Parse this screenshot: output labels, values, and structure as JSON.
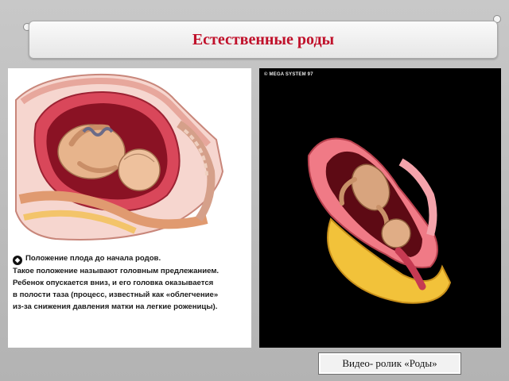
{
  "slide": {
    "title": "Естественные роды"
  },
  "left_figure": {
    "caption_lines": [
      "Положение плода до начала родов.",
      "Такое положение называют головным предлежанием.",
      "Ребенок опускается вниз, и его головка оказывается",
      "в полости таза (процесс, известный как «облегчение»",
      "из-за снижения давления матки на легкие роженицы)."
    ]
  },
  "right_figure": {
    "copyright": "© MEGA SYSTEM 97"
  },
  "video_button": {
    "label": "Видео- ролик «Роды»"
  },
  "colors": {
    "title": "#c0102a",
    "uterus": "#d9475a",
    "tissue_pink": "#f0b8b0",
    "fetus_skin": "#e7b48c",
    "amniotic": "#8a1224"
  }
}
